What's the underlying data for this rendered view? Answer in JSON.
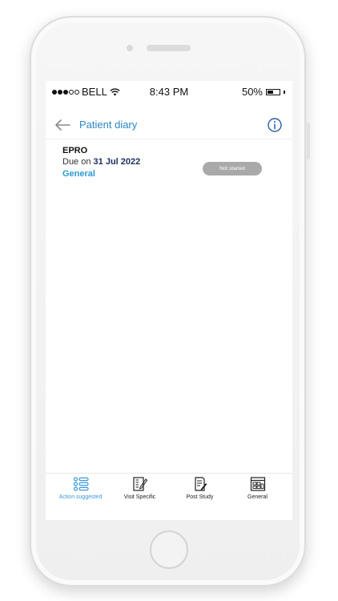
{
  "status_bar": {
    "carrier": "BELL",
    "signal_dots_filled": 3,
    "signal_dots_total": 5,
    "time": "8:43 PM",
    "battery_percent": "50%",
    "battery_level": 0.5
  },
  "header": {
    "back_icon": "arrow-left-icon",
    "title": "Patient diary",
    "info_icon": "info-circle-icon"
  },
  "diary_items": [
    {
      "title": "EPRO",
      "due_prefix": "Due on",
      "due_date": "31 Jul 2022",
      "category": "General",
      "status": "Not started"
    }
  ],
  "tabs": [
    {
      "label": "Action suggested",
      "icon": "list-icon",
      "active": true
    },
    {
      "label": "Visit Specific",
      "icon": "clipboard-edit-icon",
      "active": false
    },
    {
      "label": "Post Study",
      "icon": "document-edit-icon",
      "active": false
    },
    {
      "label": "General",
      "icon": "calendar-grid-icon",
      "active": false
    }
  ],
  "colors": {
    "accent": "#2a86c4",
    "category": "#2a9bd5",
    "active_tab": "#3a9ad9",
    "status_pill": "#a9a9a9"
  }
}
